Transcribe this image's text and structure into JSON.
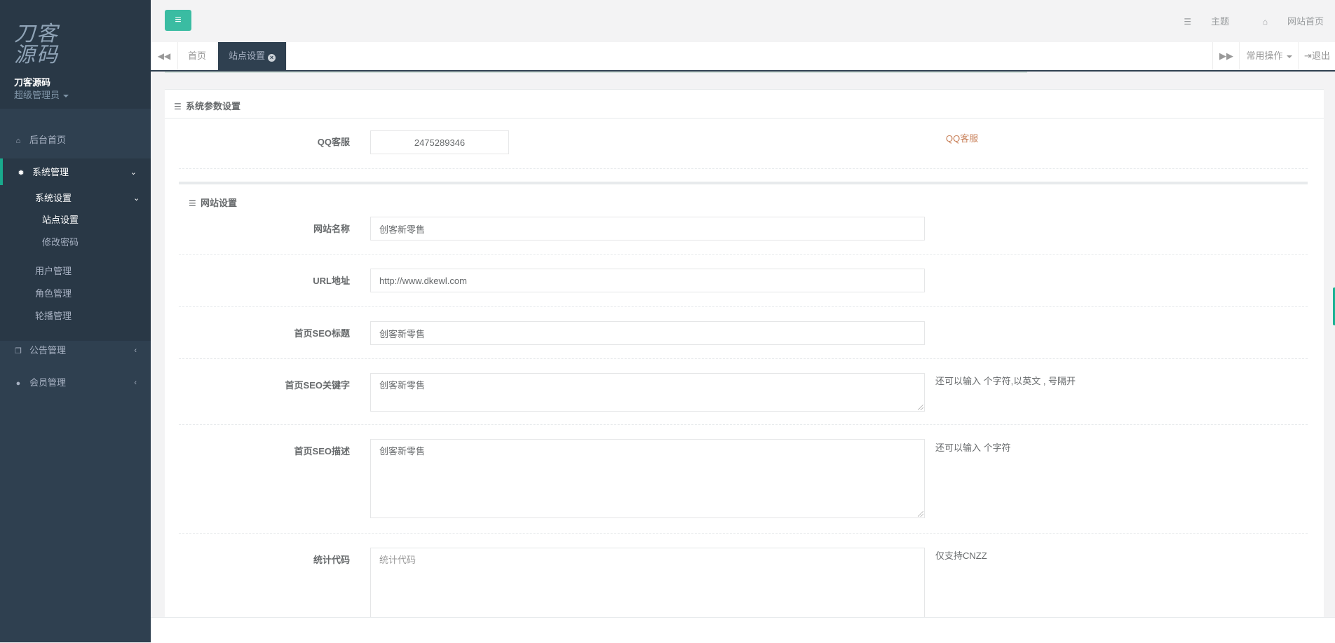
{
  "brand": {
    "logo_line1": "刀客",
    "logo_line2": "源码",
    "name": "刀客源码",
    "role": "超级管理员"
  },
  "sidebar": {
    "items": [
      {
        "label": "后台首页",
        "icon": "home-icon"
      },
      {
        "label": "系统管理",
        "icon": "gear-icon",
        "expanded": true
      },
      {
        "label": "公告管理",
        "icon": "copy-icon"
      },
      {
        "label": "会员管理",
        "icon": "user-icon"
      }
    ],
    "system_submenu": {
      "group_label": "系统设置",
      "group_children": [
        "站点设置",
        "修改密码"
      ],
      "others": [
        "用户管理",
        "角色管理",
        "轮播管理"
      ]
    }
  },
  "topbar": {
    "theme_label": "主题",
    "home_label": "网站首页"
  },
  "tabs": {
    "items": [
      {
        "label": "首页",
        "active": false
      },
      {
        "label": "站点设置",
        "active": true
      }
    ],
    "common_ops": "常用操作",
    "logout": "退出"
  },
  "panel": {
    "title": "系统参数设置",
    "qq": {
      "label": "QQ客服",
      "value": "2475289346",
      "help": "QQ客服"
    },
    "site_section_title": "网站设置",
    "fields": {
      "site_name": {
        "label": "网站名称",
        "value": "创客新零售"
      },
      "url": {
        "label": "URL地址",
        "value": "http://www.dkewl.com"
      },
      "seo_title": {
        "label": "首页SEO标题",
        "value": "创客新零售"
      },
      "seo_keywords": {
        "label": "首页SEO关键字",
        "value": "创客新零售",
        "help": "还可以输入 个字符,以英文 , 号隔开"
      },
      "seo_desc": {
        "label": "首页SEO描述",
        "value": "创客新零售",
        "help": "还可以输入 个字符"
      },
      "stats": {
        "label": "统计代码",
        "placeholder": "统计代码",
        "help": "仅支持CNZZ"
      }
    }
  },
  "colors": {
    "sidebar_bg": "#2f4050",
    "sidebar_dark": "#293846",
    "accent": "#1ab394",
    "help_orange": "#c9825b"
  }
}
